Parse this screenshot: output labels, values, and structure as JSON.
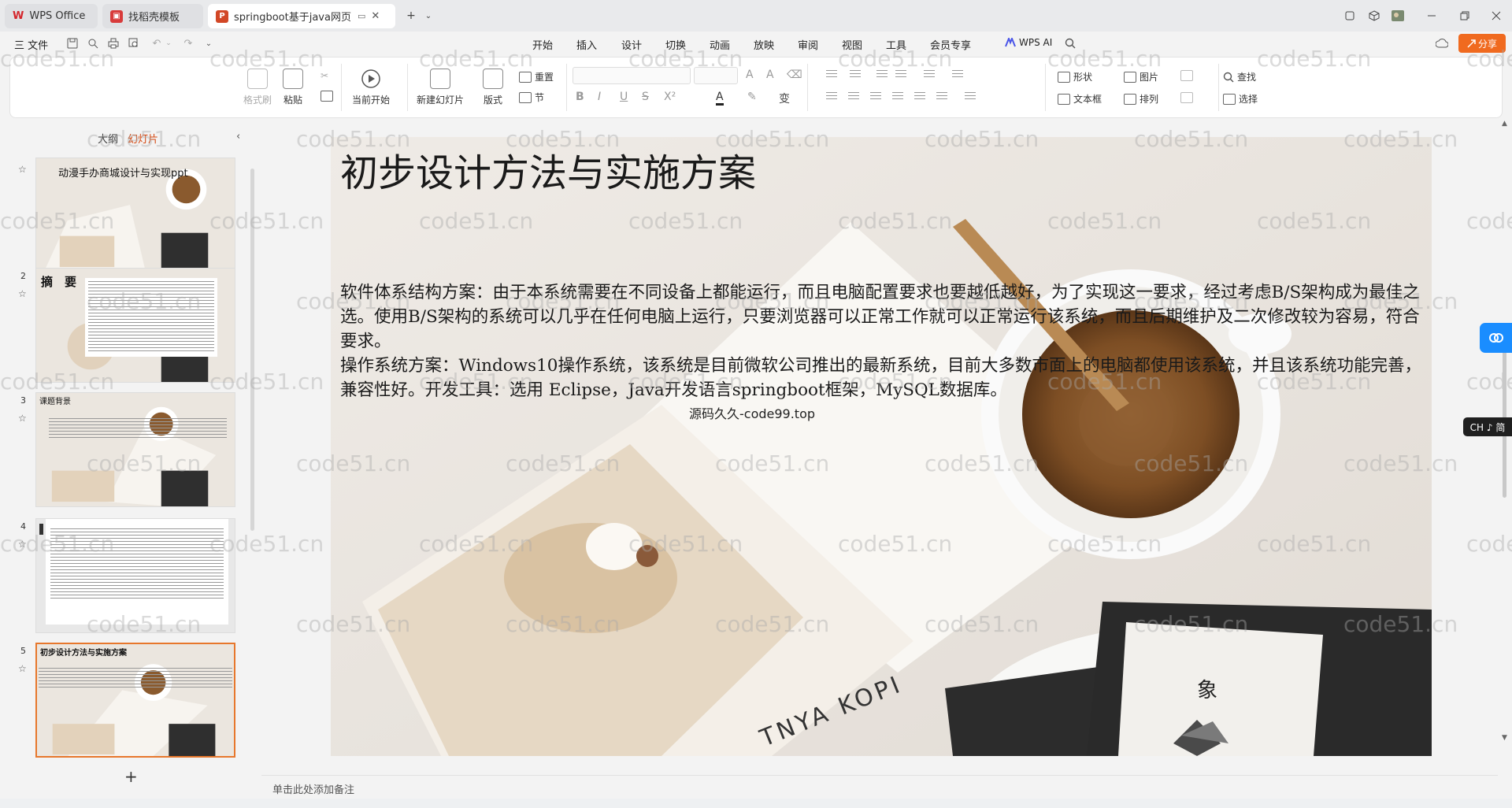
{
  "titlebar": {
    "tabs": [
      {
        "label": "WPS Office",
        "logo": "W"
      },
      {
        "label": "找稻壳模板"
      },
      {
        "label": "springboot基于java网页的"
      }
    ],
    "new_tab": "+",
    "window_controls": [
      "minimize",
      "maximize",
      "close"
    ]
  },
  "menubar": {
    "file_label": "三 文件",
    "items": [
      "开始",
      "插入",
      "设计",
      "切换",
      "动画",
      "放映",
      "审阅",
      "视图",
      "工具",
      "会员专享"
    ],
    "active_item": "开始",
    "wps_ai": "WPS AI",
    "share": "分享"
  },
  "ribbon": {
    "format_painter": "格式刷",
    "paste": "粘贴",
    "play_from_current": "当前开始",
    "new_slide": "新建幻灯片",
    "layout": "版式",
    "reset": "重置",
    "section": "节",
    "shape": "形状",
    "picture": "图片",
    "textbox": "文本框",
    "arrange": "排列",
    "find": "查找",
    "select": "选择",
    "font_buttons": [
      "B",
      "I",
      "U",
      "S",
      "X²"
    ]
  },
  "left_panel": {
    "tabs": [
      "大纲",
      "幻灯片"
    ],
    "active_tab": "幻灯片",
    "slides": [
      {
        "number": "",
        "title": "动漫手办商城设计与实现ppt"
      },
      {
        "number": "2",
        "title": "摘　要"
      },
      {
        "number": "3",
        "title": "课题背景"
      },
      {
        "number": "4",
        "title": ""
      },
      {
        "number": "5",
        "title": "初步设计方法与实施方案"
      }
    ],
    "add_slide": "+"
  },
  "slide": {
    "title": "初步设计方法与实施方案",
    "paragraphs": [
      "软件体系结构方案：由于本系统需要在不同设备上都能运行，而且电脑配置要求也要越低越好，为了实现这一要求，经过考虑B/S架构成为最佳之选。使用B/S架构的系统可以几乎在任何电脑上运行，只要浏览器可以正常工作就可以正常运行该系统，而且后期维护及二次修改较为容易，符合要求。",
      "操作系统方案：Windows10操作系统，该系统是目前微软公司推出的最新系统，目前大多数市面上的电脑都使用该系统，并且该系统功能完善，兼容性好。开发工具：选用 Eclipse，Java开发语言springboot框架，MySQL数据库。"
    ],
    "source_note": "源码久久-code99.top",
    "photo_text": "TNYA KOPI",
    "package_text": "象"
  },
  "notes_placeholder": "单击此处添加备注",
  "ime_label": "CH ♪ 简",
  "watermark": "code51.cn",
  "colors": {
    "accent": "#d4460e",
    "share": "#f06a1f",
    "selected_thumb": "#e7772c",
    "side_button": "#1a8dff"
  }
}
